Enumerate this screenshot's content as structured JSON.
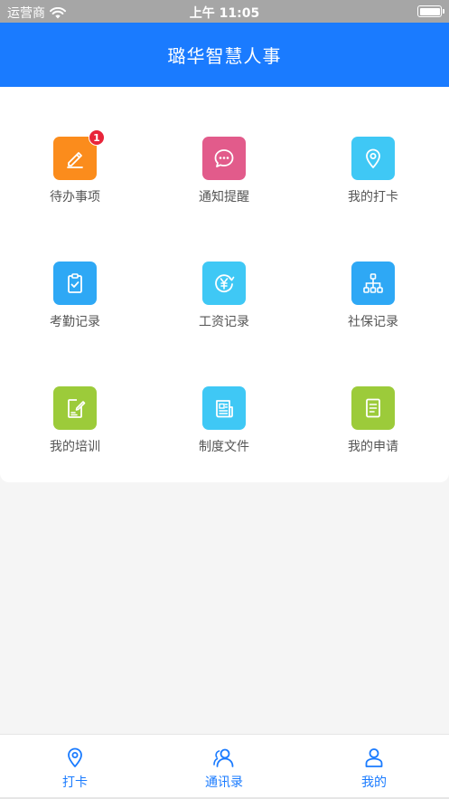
{
  "status_bar": {
    "carrier": "运营商",
    "time": "上午 11:05"
  },
  "header": {
    "title": "璐华智慧人事"
  },
  "grid": {
    "items": [
      {
        "label": "待办事项",
        "icon": "pencil-icon",
        "color": "#fb8c1c",
        "badge": "1"
      },
      {
        "label": "通知提醒",
        "icon": "chat-bubble-icon",
        "color": "#e25b8b"
      },
      {
        "label": "我的打卡",
        "icon": "location-pin-icon",
        "color": "#3fc8f5"
      },
      {
        "label": "考勤记录",
        "icon": "clipboard-check-icon",
        "color": "#2ea8f5"
      },
      {
        "label": "工资记录",
        "icon": "yen-cycle-icon",
        "color": "#3fc8f5"
      },
      {
        "label": "社保记录",
        "icon": "hierarchy-icon",
        "color": "#2ea8f5"
      },
      {
        "label": "我的培训",
        "icon": "edit-document-icon",
        "color": "#9ccb3a"
      },
      {
        "label": "制度文件",
        "icon": "newspaper-icon",
        "color": "#3fc8f5"
      },
      {
        "label": "我的申请",
        "icon": "document-lines-icon",
        "color": "#9ccb3a"
      }
    ]
  },
  "tabs": [
    {
      "label": "打卡",
      "icon": "location-pin-icon"
    },
    {
      "label": "通讯录",
      "icon": "contacts-icon"
    },
    {
      "label": "我的",
      "icon": "user-icon"
    }
  ],
  "colors": {
    "primary": "#1a7bff",
    "badge": "#e8253a"
  }
}
